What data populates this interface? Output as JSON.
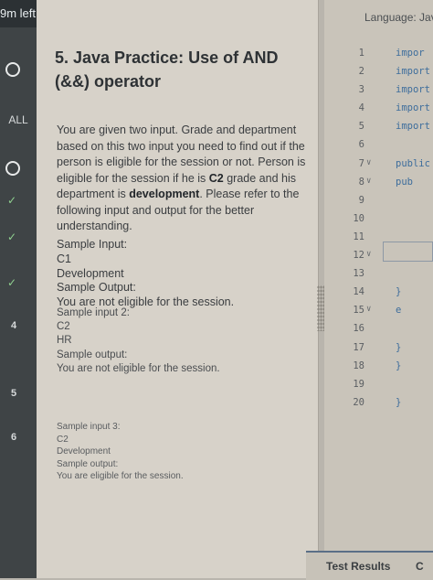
{
  "sidebar": {
    "timer": "9m left",
    "filter_label": "ALL",
    "question_numbers": [
      "4",
      "5",
      "6"
    ]
  },
  "question": {
    "title": "5. Java Practice: Use of AND (&&) operator",
    "description_parts": [
      "You are given two input. Grade and department based on this two input you need to find out if the person is eligible for the session or not. Person is eligible for the session if he is ",
      "C2",
      " grade and his department is ",
      "development",
      ". Please refer to the following input and output for the better understanding."
    ],
    "samples": [
      {
        "input_label": "Sample Input:",
        "inputs": [
          "C1",
          "Development"
        ],
        "output_label": "Sample Output:",
        "output": "You are not eligible for the session."
      },
      {
        "input_label": "Sample input 2:",
        "inputs": [
          "C2",
          "HR"
        ],
        "output_label": "Sample output:",
        "output": "You are not eligible for the session."
      },
      {
        "input_label": "Sample input 3:",
        "inputs": [
          "C2",
          "Development"
        ],
        "output_label": "Sample output:",
        "output": "You are eligible for the session."
      }
    ]
  },
  "editor": {
    "language_label": "Language: Jav",
    "lines": [
      {
        "n": "1",
        "code": "impor"
      },
      {
        "n": "2",
        "code": "import"
      },
      {
        "n": "3",
        "code": "import"
      },
      {
        "n": "4",
        "code": "import"
      },
      {
        "n": "5",
        "code": "import"
      },
      {
        "n": "6",
        "code": ""
      },
      {
        "n": "7",
        "code": "public",
        "fold": true
      },
      {
        "n": "8",
        "code": "pub",
        "fold": true
      },
      {
        "n": "9",
        "code": ""
      },
      {
        "n": "10",
        "code": ""
      },
      {
        "n": "11",
        "code": ""
      },
      {
        "n": "12",
        "code": "",
        "fold": true
      },
      {
        "n": "13",
        "code": ""
      },
      {
        "n": "14",
        "code": "}"
      },
      {
        "n": "15",
        "code": "e",
        "fold": true
      },
      {
        "n": "16",
        "code": ""
      },
      {
        "n": "17",
        "code": "}"
      },
      {
        "n": "18",
        "code": "}"
      },
      {
        "n": "19",
        "code": ""
      },
      {
        "n": "20",
        "code": "}"
      }
    ]
  },
  "bottom_tabs": {
    "test_results": "Test Results",
    "next": "C"
  },
  "colors": {
    "rail": "#3f4446",
    "content_bg": "#d7d2c9",
    "editor_bg": "#c9c4ba",
    "code_text": "#3d6d9c",
    "active_tab": "#5b6f87"
  }
}
